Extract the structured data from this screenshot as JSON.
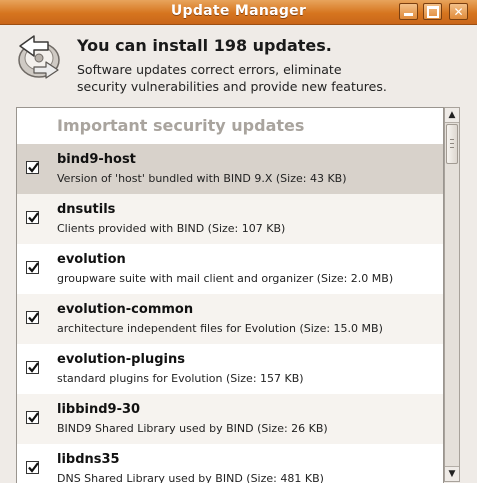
{
  "window": {
    "title": "Update Manager"
  },
  "header": {
    "headline": "You can install 198 updates.",
    "description_line1": "Software updates correct errors, eliminate",
    "description_line2": "security vulnerabilities and provide new features."
  },
  "update_list": {
    "group_title": "Important security updates",
    "items": [
      {
        "name": "bind9-host",
        "description": "Version of 'host' bundled with BIND 9.X (Size: 43 KB)",
        "checked": true
      },
      {
        "name": "dnsutils",
        "description": "Clients provided with BIND (Size: 107 KB)",
        "checked": true
      },
      {
        "name": "evolution",
        "description": "groupware suite with mail client and organizer (Size: 2.0 MB)",
        "checked": true
      },
      {
        "name": "evolution-common",
        "description": "architecture independent files for Evolution (Size: 15.0 MB)",
        "checked": true
      },
      {
        "name": "evolution-plugins",
        "description": "standard plugins for Evolution (Size: 157 KB)",
        "checked": true
      },
      {
        "name": "libbind9-30",
        "description": "BIND9 Shared Library used by BIND (Size: 26 KB)",
        "checked": true
      },
      {
        "name": "libdns35",
        "description": "DNS Shared Library used by BIND (Size: 481 KB)",
        "checked": true
      }
    ]
  }
}
